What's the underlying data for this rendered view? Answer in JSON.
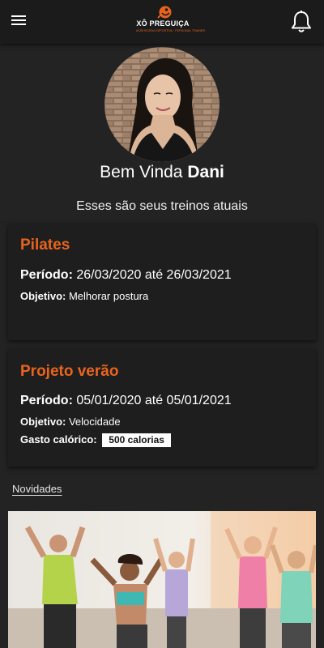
{
  "header": {
    "logo_text": "XÔ PREGUIÇA",
    "logo_subtext": "ASSESSORIA ESPORTIVA · PERSONAL TRAINER",
    "menu_icon": "hamburger-menu-icon",
    "notification_icon": "bell-icon"
  },
  "profile": {
    "greeting": "Bem Vinda",
    "name": "Dani",
    "subtitle": "Esses são seus treinos atuais"
  },
  "trainings": [
    {
      "title": "Pilates",
      "period_label": "Período:",
      "period_value": "26/03/2020 até 26/03/2021",
      "objective_label": "Objetivo:",
      "objective_value": "Melhorar postura"
    },
    {
      "title": "Projeto verão",
      "period_label": "Período:",
      "period_value": "05/01/2020 até 05/01/2021",
      "objective_label": "Objetivo:",
      "objective_value": "Velocidade",
      "calories_label": "Gasto calórico:",
      "calories_value": "500 calorias"
    }
  ],
  "news": {
    "label": "Novidades"
  },
  "colors": {
    "background": "#232323",
    "card": "#1e1e1e",
    "accent": "#e8641e",
    "text": "#ffffff"
  }
}
